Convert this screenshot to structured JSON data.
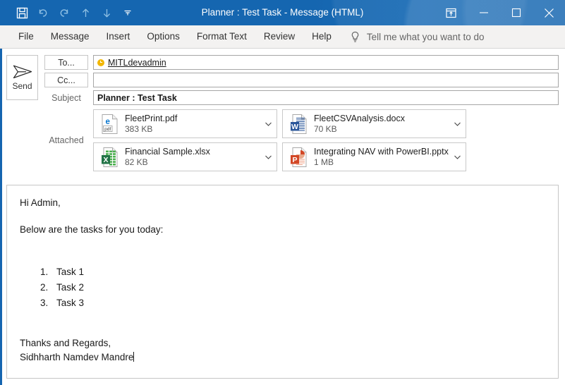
{
  "window": {
    "title": "Planner : Test Task  -  Message (HTML)",
    "accent_color": "#1566b0",
    "quick_access": [
      {
        "name": "save-icon",
        "label": "Save",
        "state": "enabled"
      },
      {
        "name": "undo-icon",
        "label": "Undo",
        "state": "disabled"
      },
      {
        "name": "redo-icon",
        "label": "Redo",
        "state": "disabled"
      },
      {
        "name": "previous-item-icon",
        "label": "Previous Item",
        "state": "disabled"
      },
      {
        "name": "next-item-icon",
        "label": "Next Item",
        "state": "disabled"
      },
      {
        "name": "customize-quick-access-toolbar-icon",
        "label": "Customize Quick Access Toolbar",
        "state": "enabled"
      }
    ],
    "controls": [
      {
        "name": "ribbon-display-options-icon",
        "label": "Ribbon Display Options"
      },
      {
        "name": "minimize-icon",
        "label": "Minimize"
      },
      {
        "name": "maximize-icon",
        "label": "Maximize"
      },
      {
        "name": "close-icon",
        "label": "Close"
      }
    ]
  },
  "menu": {
    "tabs": [
      {
        "label": "File"
      },
      {
        "label": "Message"
      },
      {
        "label": "Insert"
      },
      {
        "label": "Options"
      },
      {
        "label": "Format Text"
      },
      {
        "label": "Review"
      },
      {
        "label": "Help"
      }
    ],
    "tell_me": {
      "icon": "lightbulb-icon",
      "text": "Tell me what you want to do"
    }
  },
  "compose": {
    "send_label": "Send",
    "to_button_label": "To...",
    "cc_button_label": "Cc...",
    "subject_label": "Subject",
    "attached_label": "Attached",
    "to_recipient": "MITLdevadmin",
    "to_presence_status": "away",
    "to_presence_color": "#f2b705",
    "cc_value": "",
    "subject_value": "Planner : Test Task",
    "attachments": [
      {
        "name": "FleetPrint.pdf",
        "size": "383 KB",
        "icon": "pdf-file-icon",
        "icon_color": "#0b78d0"
      },
      {
        "name": "FleetCSVAnalysis.docx",
        "size": "70 KB",
        "icon": "word-file-icon",
        "icon_color": "#2b579a"
      },
      {
        "name": "Financial Sample.xlsx",
        "size": "82 KB",
        "icon": "excel-file-icon",
        "icon_color": "#217346"
      },
      {
        "name": "Integrating NAV with PowerBI.pptx",
        "size": "1 MB",
        "icon": "powerpoint-file-icon",
        "icon_color": "#d24726"
      }
    ]
  },
  "body": {
    "greeting": "Hi Admin,",
    "intro": "Below are the tasks for you today:",
    "tasks": [
      "Task 1",
      "Task 2",
      "Task 3"
    ],
    "signoff": "Thanks and Regards,",
    "signature": "Sidhharth Namdev Mandre"
  }
}
